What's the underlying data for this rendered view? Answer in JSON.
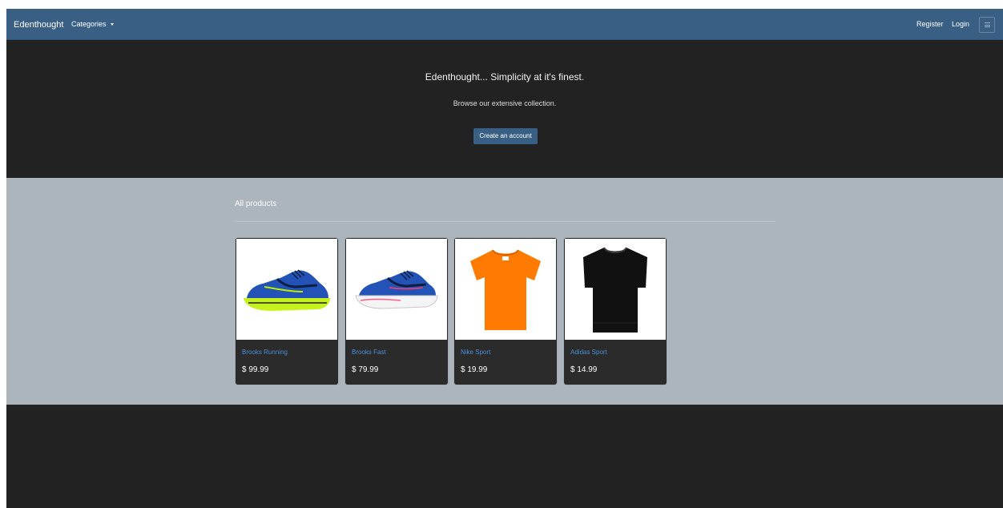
{
  "navbar": {
    "brand": "Edenthought",
    "categories_label": "Categories",
    "register_label": "Register",
    "login_label": "Login"
  },
  "hero": {
    "title": "Edenthought... Simplicity at it's finest.",
    "subtitle": "Browse our extensive collection.",
    "cta_label": "Create an account"
  },
  "products": {
    "heading": "All products",
    "items": [
      {
        "name": "Brooks Running",
        "price": "$ 99.99",
        "image": "running-shoe-yellow-sole"
      },
      {
        "name": "Brooks Fast",
        "price": "$ 79.99",
        "image": "running-shoe-white-sole"
      },
      {
        "name": "Nike Sport",
        "price": "$ 19.99",
        "image": "orange-tshirt"
      },
      {
        "name": "Adidas Sport",
        "price": "$ 14.99",
        "image": "black-tshirt"
      }
    ]
  },
  "colors": {
    "navbar": "#3a5f85",
    "page_dark": "#222222",
    "products_bg": "#acb4bc",
    "card_bg": "#2b2b2b",
    "link": "#4a90d9"
  }
}
